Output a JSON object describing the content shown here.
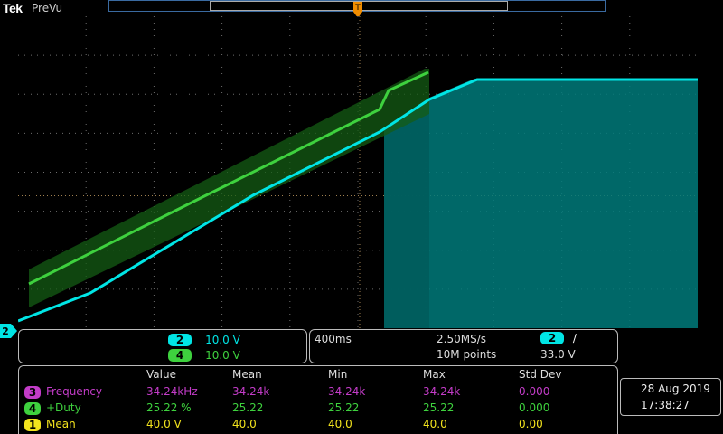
{
  "header": {
    "brand": "Tek",
    "status": "PreVu"
  },
  "colors": {
    "ch2": "#00e5e5",
    "ch3": "#c33cc8",
    "ch4": "#3ed13e",
    "ch1": "#f2e31d",
    "trigger": "#f08c00",
    "grid": "#6e6e6e",
    "record_bar": "#3a6aa0"
  },
  "icons": {
    "trigger_marker": "down-arrow-t-icon",
    "ch2_ground_marker": "right-pointer-icon",
    "edge_slope": "rising-edge-icon"
  },
  "ch2_marker_label": "2",
  "vertical": {
    "channels": [
      {
        "badge": "2",
        "scale": "10.0 V",
        "color": "#00e5e5"
      },
      {
        "badge": "4",
        "scale": "10.0 V",
        "color": "#3ed13e"
      }
    ]
  },
  "horizontal": {
    "timebase": "400ms",
    "sample_rate": "2.50MS/s",
    "record_length": "10M points",
    "trigger_channel": "2",
    "trigger_slope_icon": "∕",
    "trigger_level": "33.0 V"
  },
  "measurements": {
    "headers": [
      "Value",
      "Mean",
      "Min",
      "Max",
      "Std Dev"
    ],
    "rows": [
      {
        "badge": "3",
        "name": "Frequency",
        "color": "#c33cc8",
        "values": [
          "34.24kHz",
          "34.24k",
          "34.24k",
          "34.24k",
          "0.000"
        ]
      },
      {
        "badge": "4",
        "name": "+Duty",
        "color": "#3ed13e",
        "values": [
          "25.22 %",
          "25.22",
          "25.22",
          "25.22",
          "0.000"
        ]
      },
      {
        "badge": "1",
        "name": "Mean",
        "color": "#f2e31d",
        "values": [
          "40.0 V",
          "40.0",
          "40.0",
          "40.0",
          "0.00"
        ]
      }
    ]
  },
  "datetime": {
    "date": "28 Aug 2019",
    "time": "17:38:27"
  }
}
